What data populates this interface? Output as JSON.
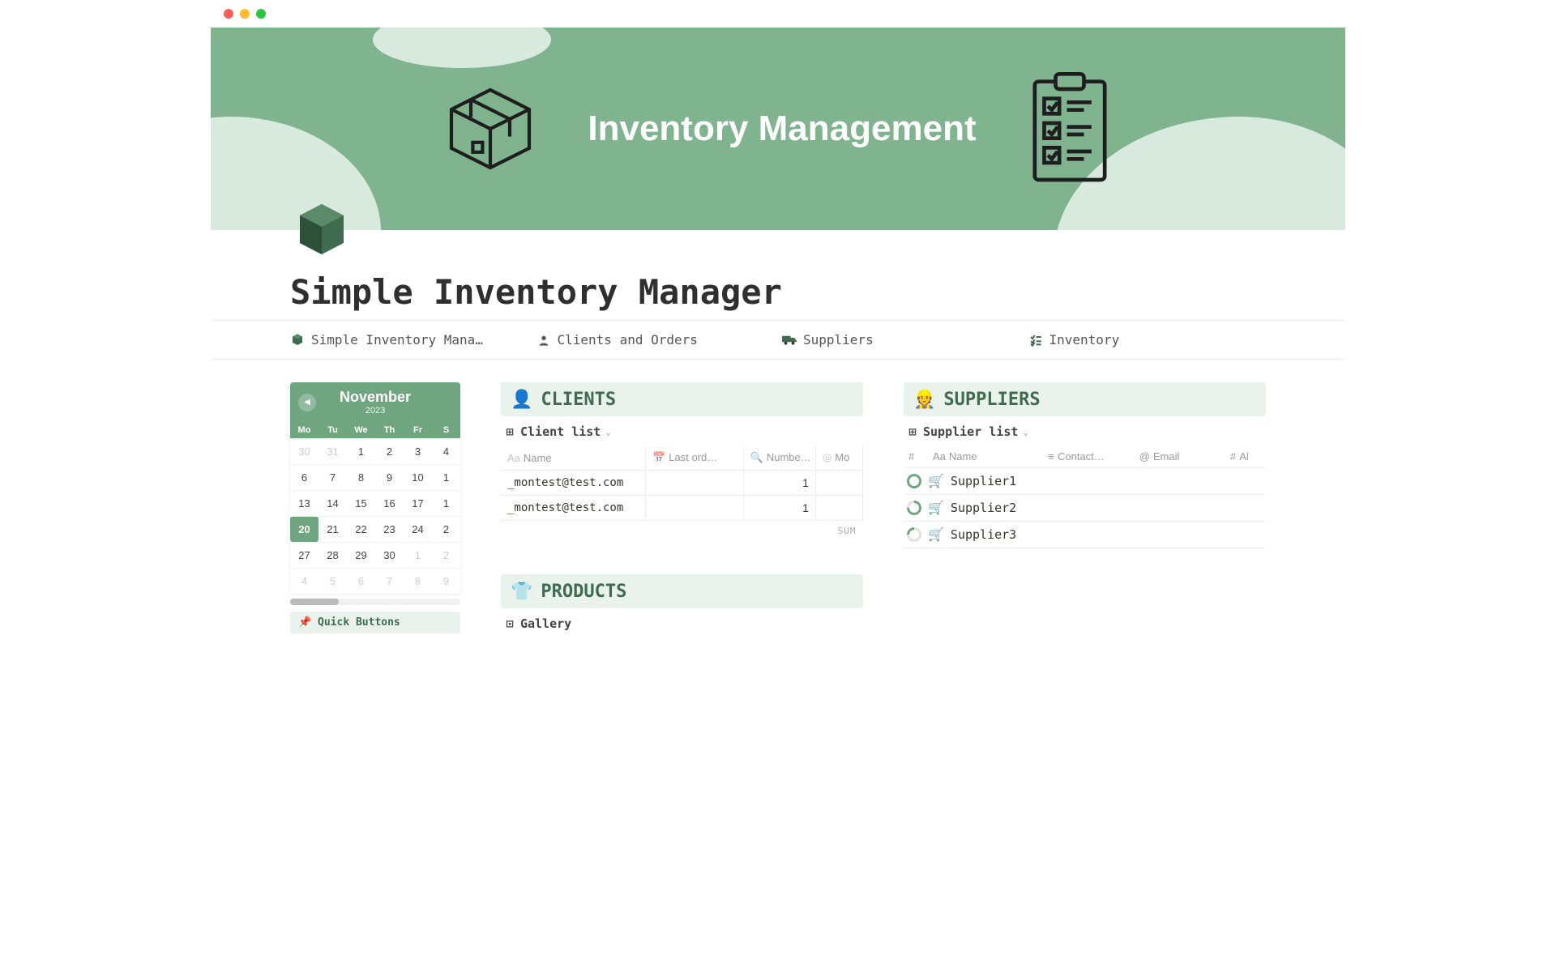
{
  "hero": {
    "title": "Inventory Management"
  },
  "page": {
    "title": "Simple Inventory Manager"
  },
  "tabs": [
    {
      "label": "Simple Inventory Mana…"
    },
    {
      "label": "Clients and Orders"
    },
    {
      "label": "Suppliers"
    },
    {
      "label": "Inventory"
    }
  ],
  "calendar": {
    "month": "November",
    "year": "2023",
    "days_of_week": [
      "Mo",
      "Tu",
      "We",
      "Th",
      "Fr",
      "S"
    ],
    "weeks": [
      [
        {
          "d": "30",
          "dim": true
        },
        {
          "d": "31",
          "dim": true
        },
        {
          "d": "1"
        },
        {
          "d": "2"
        },
        {
          "d": "3"
        },
        {
          "d": "4"
        }
      ],
      [
        {
          "d": "6"
        },
        {
          "d": "7"
        },
        {
          "d": "8"
        },
        {
          "d": "9"
        },
        {
          "d": "10"
        },
        {
          "d": "1"
        }
      ],
      [
        {
          "d": "13"
        },
        {
          "d": "14"
        },
        {
          "d": "15"
        },
        {
          "d": "16"
        },
        {
          "d": "17"
        },
        {
          "d": "1"
        }
      ],
      [
        {
          "d": "20",
          "today": true
        },
        {
          "d": "21"
        },
        {
          "d": "22"
        },
        {
          "d": "23"
        },
        {
          "d": "24"
        },
        {
          "d": "2"
        }
      ],
      [
        {
          "d": "27"
        },
        {
          "d": "28"
        },
        {
          "d": "29"
        },
        {
          "d": "30"
        },
        {
          "d": "1",
          "dim": true
        },
        {
          "d": "2",
          "dim": true
        }
      ],
      [
        {
          "d": "4",
          "dim": true
        },
        {
          "d": "5",
          "dim": true
        },
        {
          "d": "6",
          "dim": true
        },
        {
          "d": "7",
          "dim": true
        },
        {
          "d": "8",
          "dim": true
        },
        {
          "d": "9",
          "dim": true
        }
      ]
    ],
    "quick_buttons_label": "Quick Buttons"
  },
  "clients": {
    "emoji": "👤",
    "title": "CLIENTS",
    "view_label": "Client list",
    "columns": [
      "Name",
      "Last ord…",
      "Numbe…",
      "Mo"
    ],
    "rows": [
      {
        "name": "_montest@test.com",
        "last_order": "",
        "number": "1",
        "mo": ""
      },
      {
        "name": "_montest@test.com",
        "last_order": "",
        "number": "1",
        "mo": ""
      }
    ],
    "footer": "SUM"
  },
  "suppliers": {
    "emoji": "👷",
    "title": "SUPPLIERS",
    "view_label": "Supplier list",
    "columns": [
      "#",
      "Name",
      "Contact…",
      "Email",
      "Al"
    ],
    "rows": [
      {
        "name": "Supplier1"
      },
      {
        "name": "Supplier2"
      },
      {
        "name": "Supplier3"
      }
    ]
  },
  "products": {
    "emoji": "👕",
    "title": "PRODUCTS",
    "view_label": "Gallery"
  }
}
